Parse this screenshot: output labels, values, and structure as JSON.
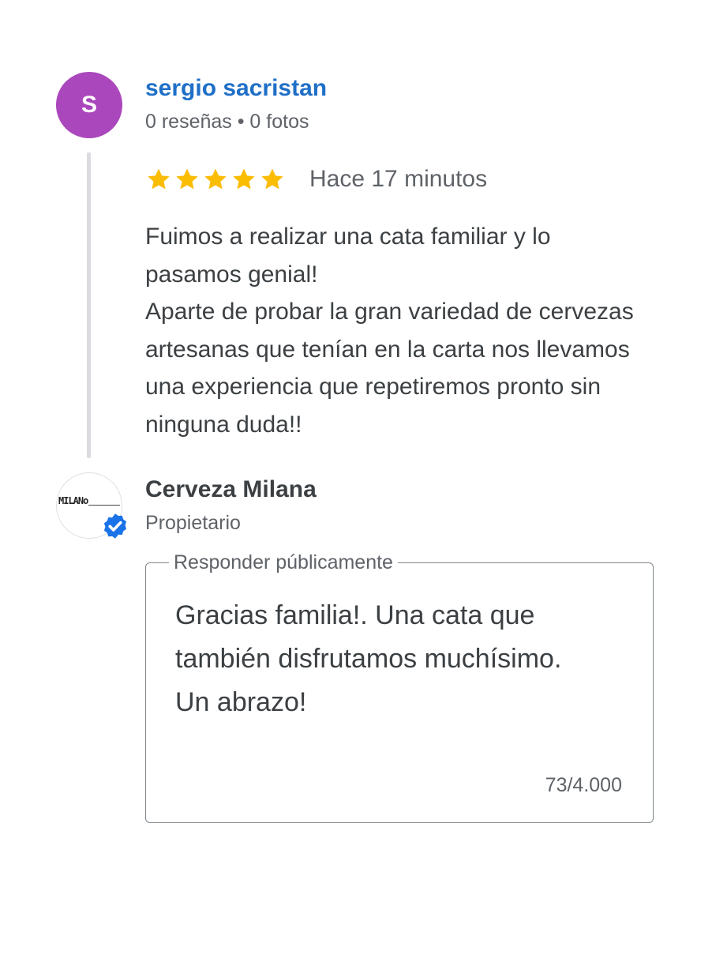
{
  "review": {
    "reviewer_initial": "S",
    "reviewer_name": "sergio sacristan",
    "reviewer_meta": "0 reseñas • 0 fotos",
    "rating": 5,
    "time_ago": "Hace 17 minutos",
    "text_lines": [
      "Fuimos a realizar una cata familiar y lo",
      "pasamos genial!",
      "Aparte de probar la gran variedad de cervezas",
      "artesanas que tenían en la carta nos llevamos",
      "una experiencia que repetiremos pronto sin",
      "ninguna duda!!"
    ]
  },
  "owner": {
    "logo_text": "MILANo",
    "name": "Cerveza Milana",
    "role": "Propietario"
  },
  "reply": {
    "label": "Responder públicamente",
    "text": "Gracias familia!. Una cata que\ntambién disfrutamos muchísimo.\nUn abrazo!",
    "counter": "73/4.000"
  },
  "colors": {
    "avatar_bg": "#ab47bc",
    "reviewer_name": "#1f6fc7",
    "star": "#fbbc04",
    "verified": "#1a73e8"
  }
}
